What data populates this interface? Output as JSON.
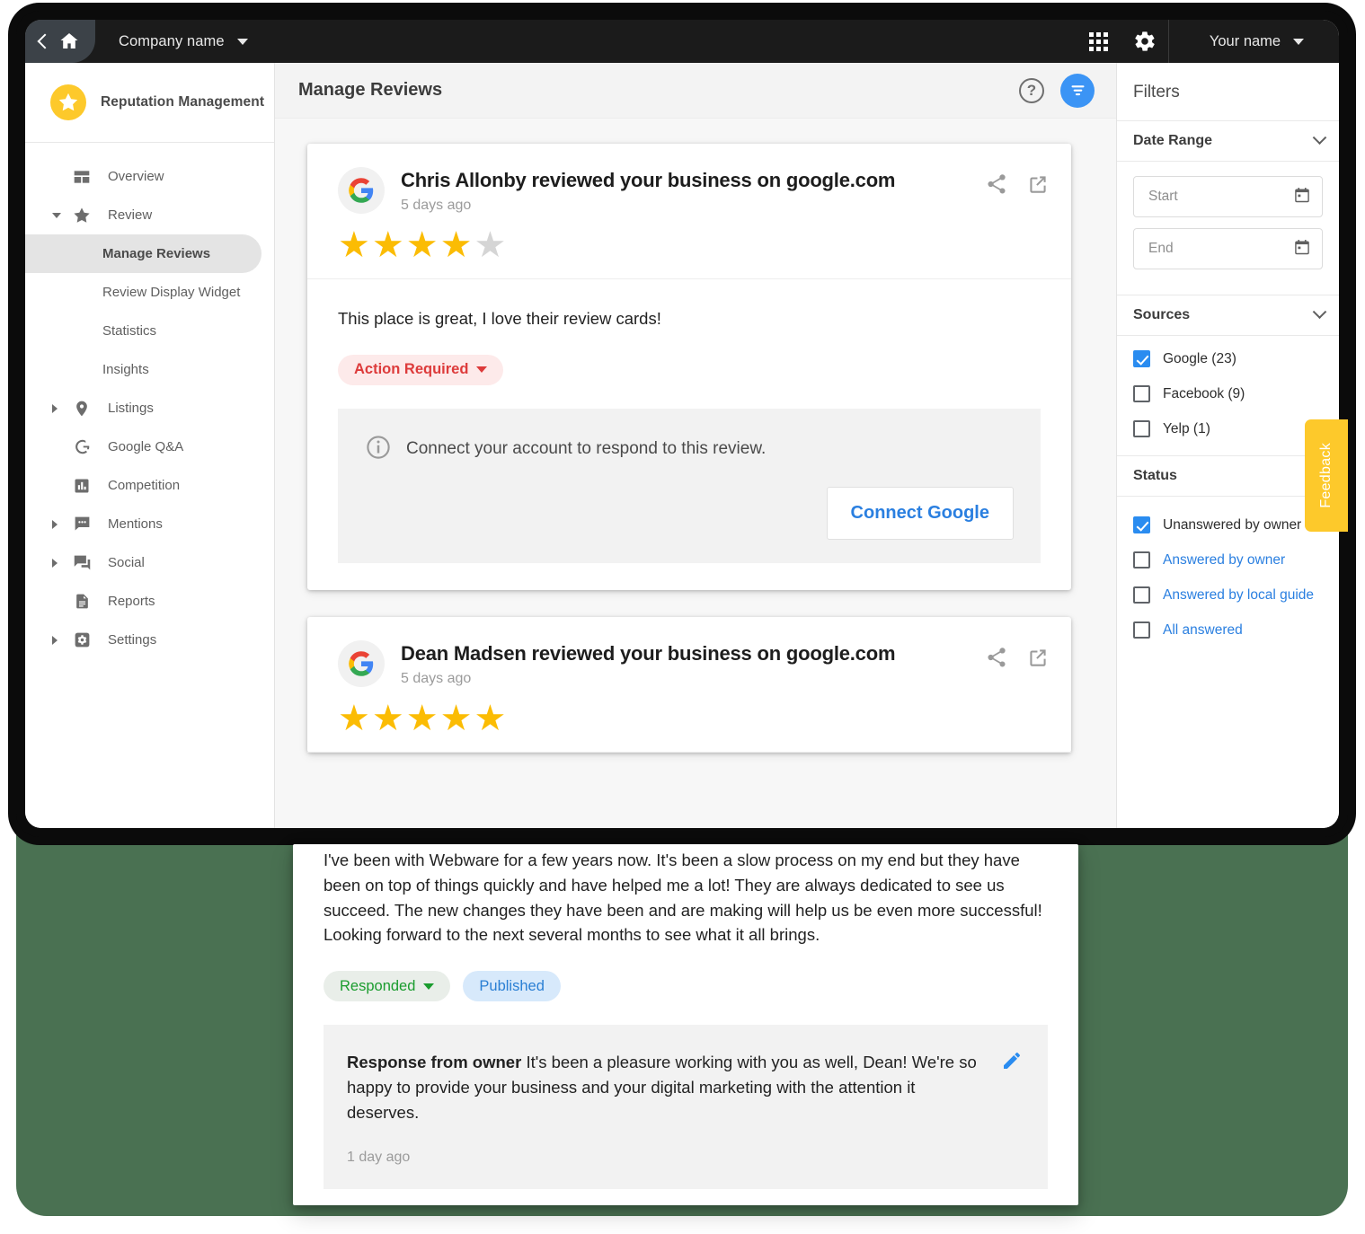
{
  "topbar": {
    "back_icon": "back-chevron-icon",
    "home_icon": "home-icon",
    "company_name": "Company name",
    "apps_icon": "apps-grid-icon",
    "settings_icon": "gear-icon",
    "user_name": "Your name"
  },
  "sidebar": {
    "brand": "Reputation Management",
    "brand_icon": "star-badge-icon",
    "items": [
      {
        "label": "Overview",
        "icon": "dashboard-icon",
        "expandable": false,
        "expanded": false
      },
      {
        "label": "Review",
        "icon": "star-icon",
        "expandable": true,
        "expanded": true
      },
      {
        "label": "Listings",
        "icon": "map-pin-icon",
        "expandable": true,
        "expanded": false
      },
      {
        "label": "Google Q&A",
        "icon": "google-g-icon",
        "expandable": false,
        "expanded": false
      },
      {
        "label": "Competition",
        "icon": "bar-chart-icon",
        "expandable": false,
        "expanded": false
      },
      {
        "label": "Mentions",
        "icon": "comment-icon",
        "expandable": true,
        "expanded": false
      },
      {
        "label": "Social",
        "icon": "chat-bubbles-icon",
        "expandable": true,
        "expanded": false
      },
      {
        "label": "Reports",
        "icon": "document-icon",
        "expandable": false,
        "expanded": false
      },
      {
        "label": "Settings",
        "icon": "gear-icon",
        "expandable": true,
        "expanded": false
      }
    ],
    "review_subitems": [
      {
        "label": "Manage Reviews",
        "active": true
      },
      {
        "label": "Review Display Widget",
        "active": false
      },
      {
        "label": "Statistics",
        "active": false
      },
      {
        "label": "Insights",
        "active": false
      }
    ]
  },
  "page": {
    "title": "Manage Reviews",
    "help_icon": "help-circle-icon",
    "filter_fab_icon": "filter-icon"
  },
  "reviews": [
    {
      "source_icon": "google-g-icon",
      "title": "Chris Allonby reviewed your business on google.com",
      "time": "5 days ago",
      "rating": 4,
      "max_rating": 5,
      "text": "This place is great, I love their review cards!",
      "share_icon": "share-icon",
      "open_icon": "external-link-icon",
      "badges": [
        {
          "label": "Action Required",
          "style": "action",
          "has_caret": true
        }
      ],
      "connect_panel": {
        "info_icon": "info-circle-icon",
        "message": "Connect your account to respond to this review.",
        "button_label": "Connect Google"
      }
    },
    {
      "source_icon": "google-g-icon",
      "title": "Dean Madsen reviewed your business on google.com",
      "time": "5 days ago",
      "rating": 5,
      "max_rating": 5,
      "text": "I've been with Webware for a few years now. It's been a slow process on my end but they have been on top of things quickly and have helped me a lot! They are always dedicated to see us succeed. The new changes they have been and are making will help us be even more successful! Looking forward to the next several months to see what it all brings.",
      "share_icon": "share-icon",
      "open_icon": "external-link-icon",
      "badges": [
        {
          "label": "Responded",
          "style": "responded",
          "has_caret": true
        },
        {
          "label": "Published",
          "style": "published",
          "has_caret": false
        }
      ],
      "response": {
        "label": "Response from owner",
        "text": "It's been a pleasure working with you as well, Dean! We're so happy to provide your business and your digital marketing with the attention it deserves.",
        "time": "1 day ago",
        "edit_icon": "pencil-icon"
      }
    }
  ],
  "filters": {
    "title": "Filters",
    "sections": [
      {
        "label": "Date Range",
        "chevron": "chevron-down-icon"
      },
      {
        "label": "Sources",
        "chevron": "chevron-down-icon"
      },
      {
        "label": "Status",
        "chevron": ""
      }
    ],
    "date_range": {
      "start_placeholder": "Start",
      "start_value": "",
      "end_placeholder": "End",
      "end_value": "",
      "calendar_icon": "calendar-icon"
    },
    "sources": [
      {
        "label": "Google (23)",
        "checked": true
      },
      {
        "label": "Facebook (9)",
        "checked": false
      },
      {
        "label": "Yelp (1)",
        "checked": false
      }
    ],
    "status": [
      {
        "label": "Unanswered by owner",
        "checked": true,
        "link": false
      },
      {
        "label": "Answered by owner",
        "checked": false,
        "link": true
      },
      {
        "label": "Answered by local guide",
        "checked": false,
        "link": true
      },
      {
        "label": "All answered",
        "checked": false,
        "link": true
      }
    ]
  },
  "feedback_tab": {
    "label": "Feedback"
  },
  "colors": {
    "accent_blue": "#2a7fe0",
    "fab_blue": "#3b94f5",
    "brand_yellow": "#fdc92b",
    "star_gold": "#FBBC04",
    "action_red": "#dd3b3b",
    "responded_green": "#1a9c2e",
    "published_blue": "#2a7fd4",
    "backdrop_green": "#4a7152",
    "topbar_black": "#1b1b1b"
  }
}
